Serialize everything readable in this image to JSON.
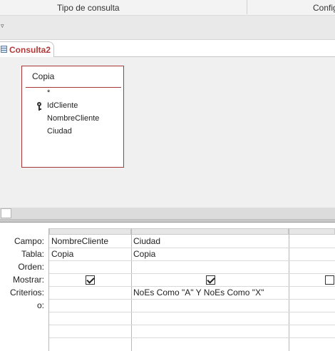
{
  "ribbon": {
    "group1": "Tipo de consulta",
    "group2": "Config"
  },
  "qat": {
    "dropdown_icon": "dropdown-arrow-icon"
  },
  "document_tab": {
    "label": "Consulta2",
    "icon": "query-icon"
  },
  "table_box": {
    "title": "Copia",
    "fields": [
      {
        "label": "*",
        "primary_key": false
      },
      {
        "label": "IdCliente",
        "primary_key": true
      },
      {
        "label": "NombreCliente",
        "primary_key": false
      },
      {
        "label": "Ciudad",
        "primary_key": false
      }
    ]
  },
  "grid": {
    "row_labels": [
      "Campo:",
      "Tabla:",
      "Orden:",
      "Mostrar:",
      "Criterios:",
      "o:"
    ],
    "columns": [
      {
        "campo": "NombreCliente",
        "tabla": "Copia",
        "orden": "",
        "mostrar": true,
        "criterios": "",
        "o": ""
      },
      {
        "campo": "Ciudad",
        "tabla": "Copia",
        "orden": "",
        "mostrar": true,
        "criterios": "NoEs Como \"A\" Y NoEs Como \"X\"",
        "o": ""
      },
      {
        "campo": "",
        "tabla": "",
        "orden": "",
        "mostrar": false,
        "criterios": "",
        "o": ""
      }
    ]
  }
}
